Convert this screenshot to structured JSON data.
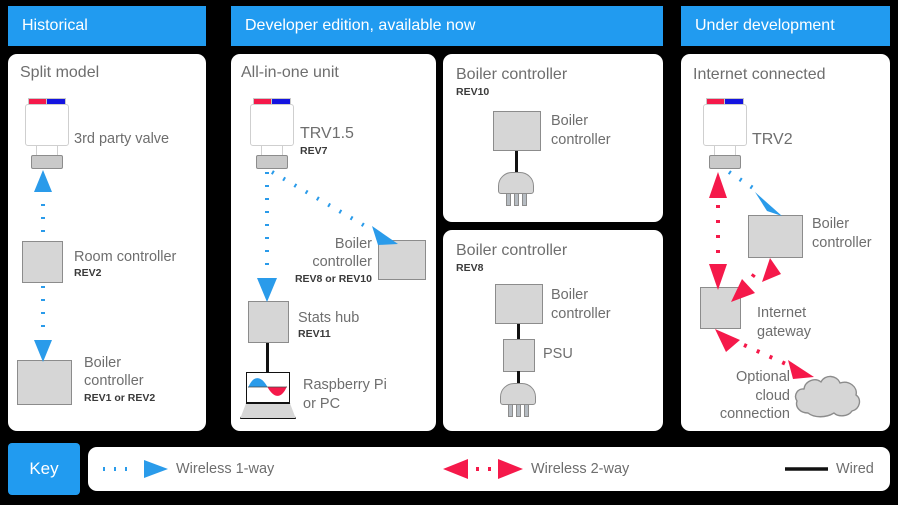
{
  "columns": [
    {
      "header": "Historical"
    },
    {
      "header": "Developer edition, available now"
    },
    {
      "header": "Under development"
    }
  ],
  "cards": {
    "split_model": {
      "title": "Split model",
      "devices": {
        "valve_label": "3rd party valve",
        "room_controller_label": "Room controller",
        "room_controller_rev": "REV2",
        "boiler_line1": "Boiler",
        "boiler_line2": "controller",
        "boiler_rev": "REV1 or REV2"
      }
    },
    "all_in_one": {
      "title": "All-in-one unit",
      "devices": {
        "trv_label": "TRV1.5",
        "trv_rev": "REV7",
        "boiler_line1": "Boiler",
        "boiler_line2": "controller",
        "boiler_rev": "REV8 or REV10",
        "hub_label": "Stats hub",
        "hub_rev": "REV11",
        "pi_line1": "Raspberry Pi",
        "pi_line2": "or PC"
      }
    },
    "boiler_rev10": {
      "title": "Boiler controller",
      "subtitle": "REV10",
      "devices": {
        "boiler_line1": "Boiler",
        "boiler_line2": "controller"
      }
    },
    "boiler_rev8": {
      "title": "Boiler controller",
      "subtitle": "REV8",
      "devices": {
        "boiler_line1": "Boiler",
        "boiler_line2": "controller",
        "psu_label": "PSU"
      }
    },
    "internet_connected": {
      "title": "Internet connected",
      "devices": {
        "trv_label": "TRV2",
        "boiler_line1": "Boiler",
        "boiler_line2": "controller",
        "gateway_line1": "Internet",
        "gateway_line2": "gateway",
        "cloud_line1": "Optional",
        "cloud_line2": "cloud",
        "cloud_line3": "connection"
      }
    }
  },
  "key": {
    "label": "Key",
    "items": [
      {
        "name": "wireless-1-way",
        "label": "Wireless 1-way"
      },
      {
        "name": "wireless-2-way",
        "label": "Wireless 2-way"
      },
      {
        "name": "wired",
        "label": "Wired"
      }
    ]
  },
  "colors": {
    "accent_blue": "#219BF0",
    "wireless_one_way": "#2A9BEA",
    "wireless_two_way": "#F5194A",
    "wired": "#111111",
    "device_fill": "#D6D6D6",
    "device_stroke": "#8C8C8C",
    "background": "#000000",
    "card": "#FFFFFF",
    "text": "#6E6E6E"
  }
}
